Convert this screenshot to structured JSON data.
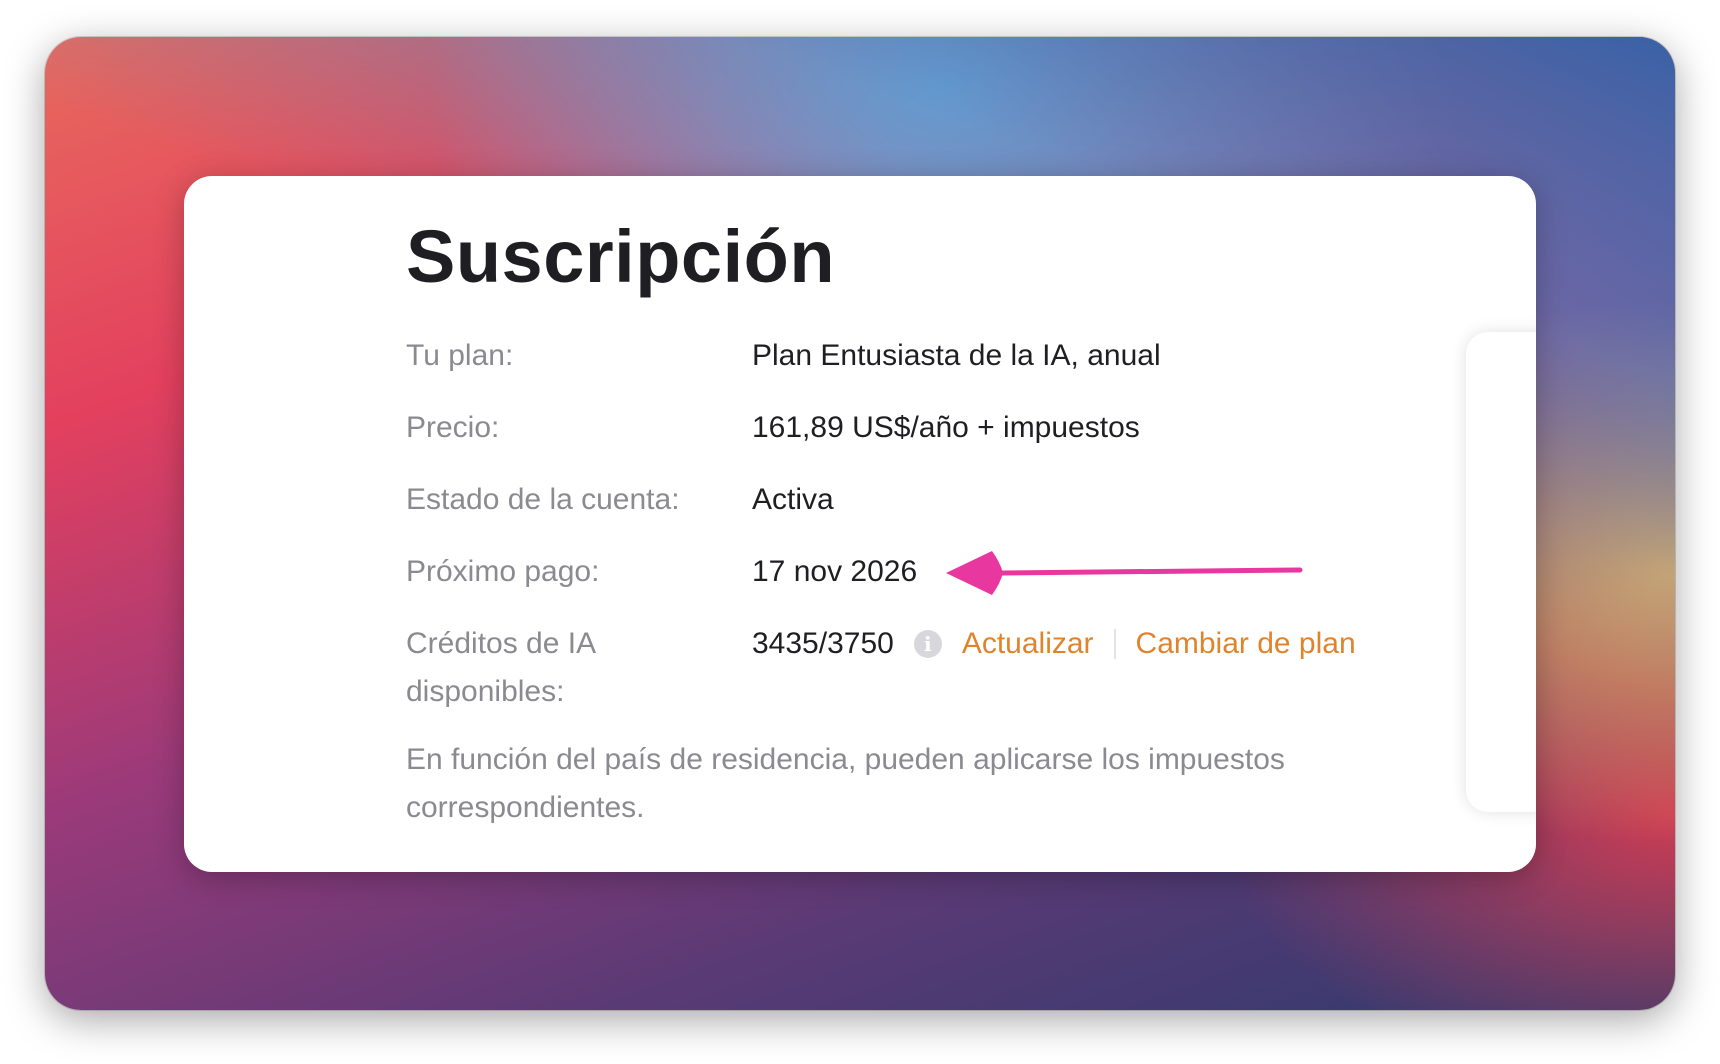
{
  "subscription": {
    "title": "Suscripción",
    "rows": [
      {
        "label": "Tu plan:",
        "value": "Plan Entusiasta de la IA, anual"
      },
      {
        "label": "Precio:",
        "value": "161,89 US$/año + impuestos"
      },
      {
        "label": "Estado de la cuenta:",
        "value": "Activa"
      },
      {
        "label": "Próximo pago:",
        "value": "17 nov 2026"
      }
    ],
    "credits": {
      "label": "Créditos de IA disponibles:",
      "value": "3435/3750",
      "info_icon_glyph": "i",
      "upgrade_label": "Actualizar",
      "change_plan_label": "Cambiar de plan"
    },
    "note": "En función del país de residencia, pueden aplicarse los impuestos correspondientes."
  },
  "icons": {
    "info": "info-icon",
    "annotation_arrow": "arrow-left-icon"
  },
  "colors": {
    "link": "#e0842c",
    "annotation_arrow": "#e8389f",
    "label": "#8a8a90",
    "value": "#1f1f23"
  }
}
